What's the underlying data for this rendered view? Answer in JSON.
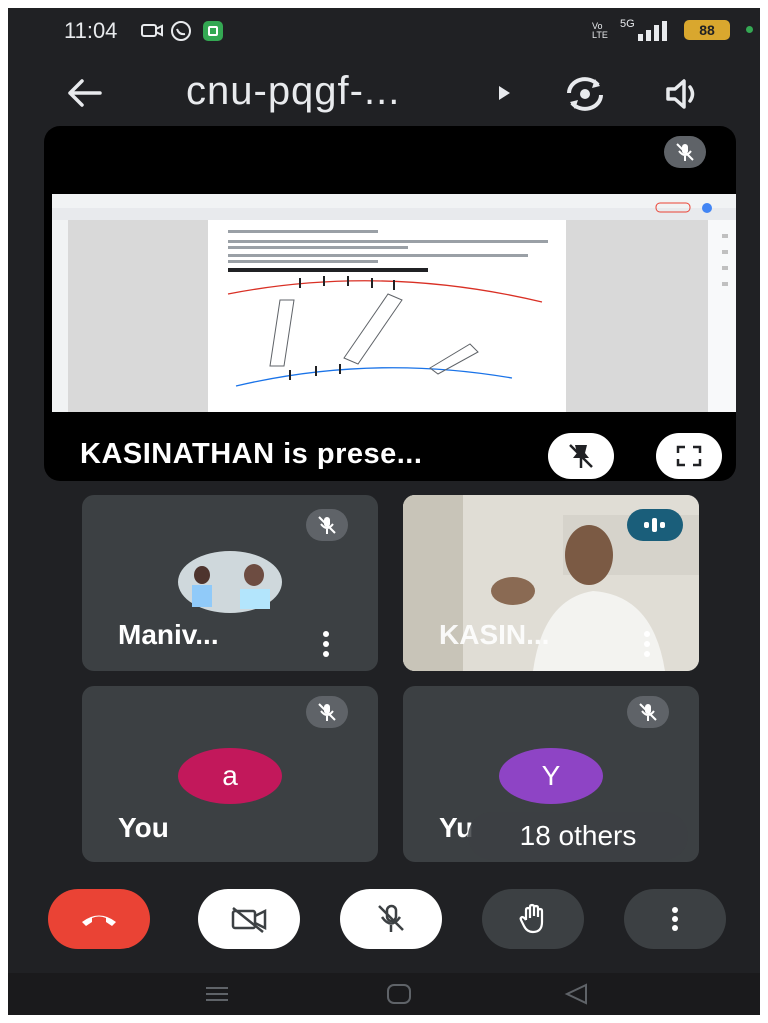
{
  "status_bar": {
    "time": "11:04",
    "network": "5G",
    "battery": "88",
    "volte": "Vo LTE"
  },
  "top_bar": {
    "meeting_code": "cnu-pqgf-..."
  },
  "presentation": {
    "label": "KASINATHAN is prese..."
  },
  "participants": [
    {
      "name": "Maniv..."
    },
    {
      "name": "KASIN..."
    },
    {
      "name": "You",
      "avatar_letter": "a",
      "avatar_color": "#c2185b"
    },
    {
      "name": "Yu",
      "avatar_letter": "Y",
      "avatar_color": "#8e44c5"
    }
  ],
  "others_count": "18 others",
  "colors": {
    "end_call": "#ea4335",
    "background": "#202124",
    "tile": "#3c4043",
    "speaking": "#1a5e7a"
  },
  "icons": {
    "back": "arrow-left",
    "rotate": "switch-camera",
    "speaker": "speaker",
    "mic_off": "mic-off",
    "unpin": "pin-off",
    "fullscreen": "fullscreen",
    "end_call": "phone-hangup",
    "camera_off": "video-off",
    "hand": "raise-hand",
    "more": "more-vertical"
  }
}
